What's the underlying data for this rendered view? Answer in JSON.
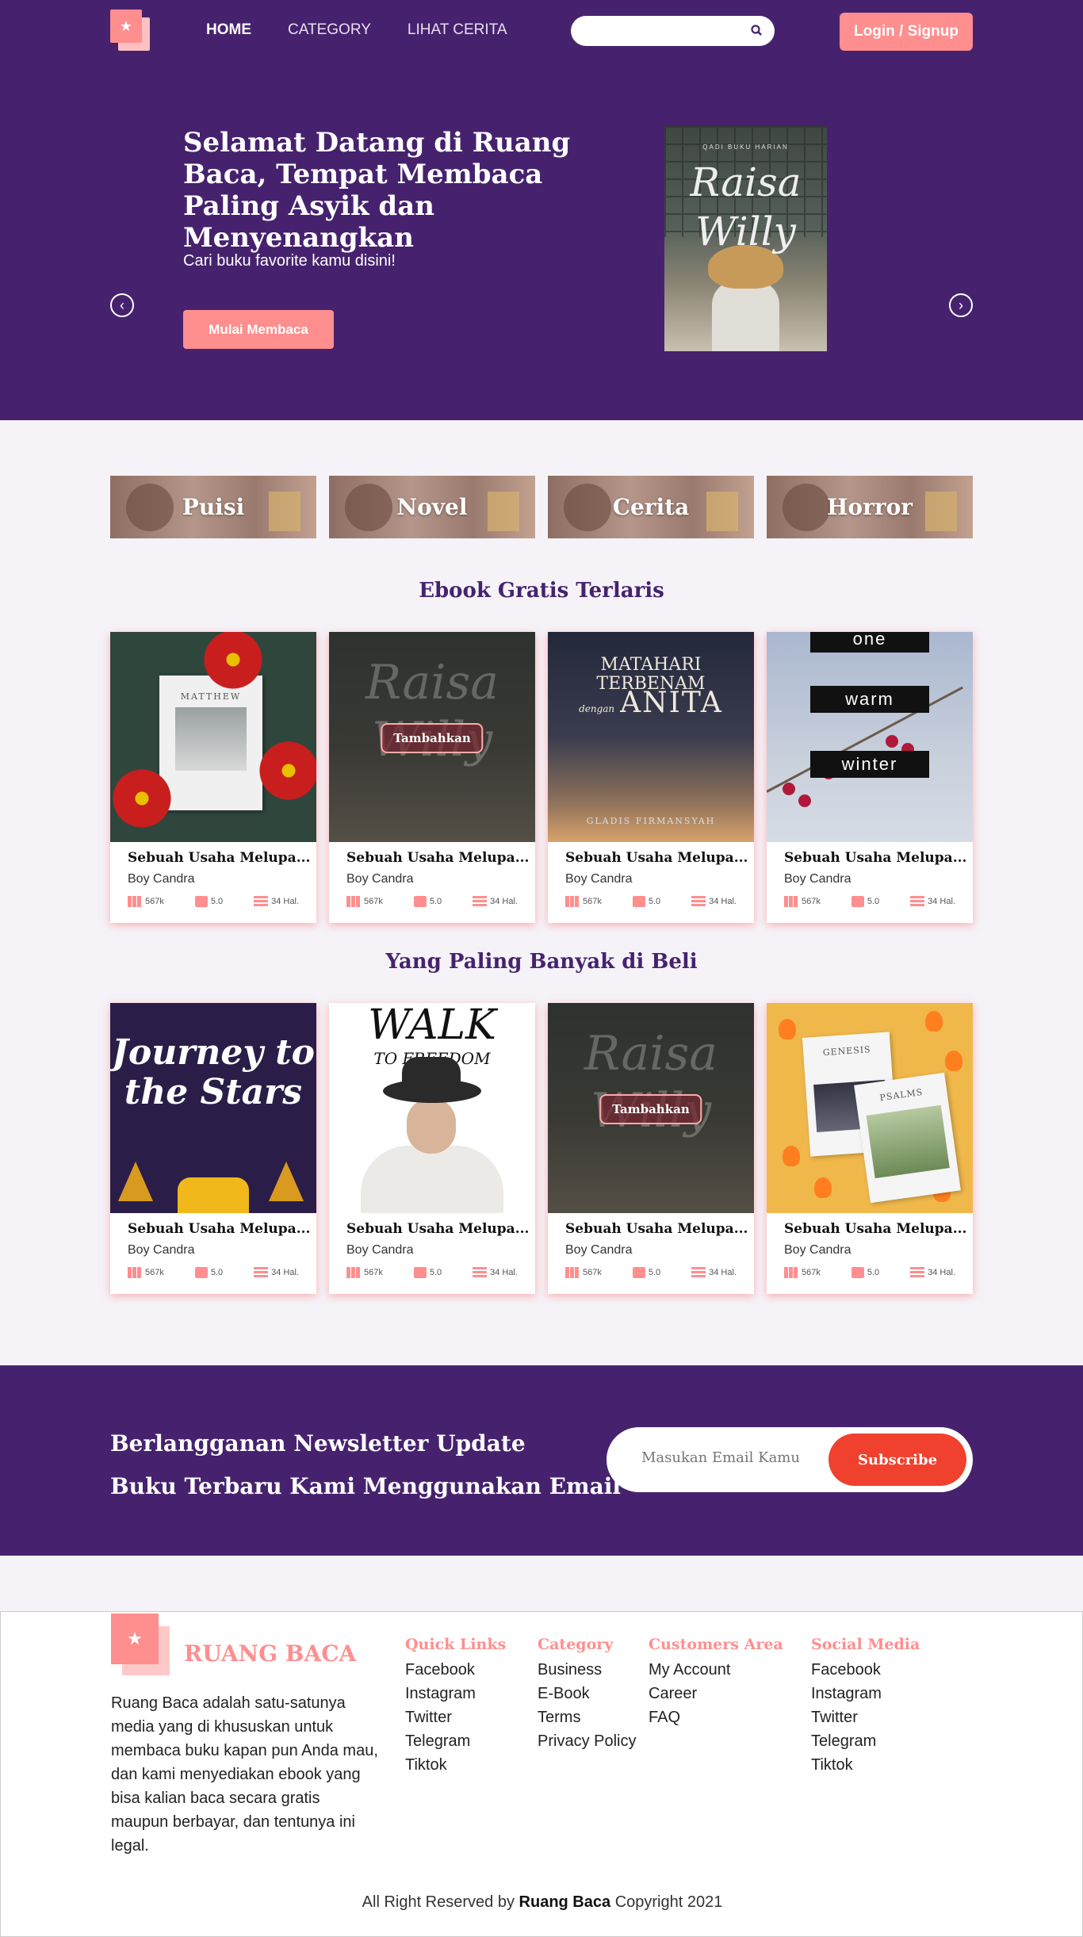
{
  "nav": {
    "links": [
      "HOME",
      "CATEGORY",
      "LIHAT CERITA"
    ],
    "search_placeholder": "",
    "login_label": "Login / Signup"
  },
  "hero": {
    "title": "Selamat Datang di Ruang Baca, Tempat Membaca Paling Asyik dan Menyenangkan",
    "subtitle": "Cari buku favorite kamu disini!",
    "cta_label": "Mulai Membaca",
    "cover_small": "QADI BUKU HARIAN",
    "cover_title": "Raisa Willy"
  },
  "categories": [
    "Puisi",
    "Novel",
    "Cerita",
    "Horror"
  ],
  "sections": [
    {
      "title": "Ebook Gratis Terlaris",
      "books": [
        {
          "title": "Sebuah Usaha Melupa...",
          "author": "Boy Candra",
          "views": "567k",
          "rating": "5.0",
          "pages": "34 Hal.",
          "cover_text": "MATTHEW"
        },
        {
          "title": "Sebuah Usaha Melupa...",
          "author": "Boy Candra",
          "views": "567k",
          "rating": "5.0",
          "pages": "34 Hal.",
          "cover_text": "Raisa Willy",
          "overlay": "Tambahkan"
        },
        {
          "title": "Sebuah Usaha Melupa...",
          "author": "Boy Candra",
          "views": "567k",
          "rating": "5.0",
          "pages": "34 Hal.",
          "cover_text": "MATAHARI TERBENAM",
          "cover_text2": "ANITA",
          "cover_text3": "dengan",
          "cover_author": "GLADIS FIRMANSYAH"
        },
        {
          "title": "Sebuah Usaha Melupa...",
          "author": "Boy Candra",
          "views": "567k",
          "rating": "5.0",
          "pages": "34 Hal.",
          "cover_words": [
            "one",
            "warm",
            "winter"
          ]
        }
      ]
    },
    {
      "title": "Yang Paling Banyak di Beli",
      "books": [
        {
          "title": "Sebuah Usaha Melupa...",
          "author": "Boy Candra",
          "views": "567k",
          "rating": "5.0",
          "pages": "34 Hal.",
          "cover_text": "Journey to the Stars"
        },
        {
          "title": "Sebuah Usaha Melupa...",
          "author": "Boy Candra",
          "views": "567k",
          "rating": "5.0",
          "pages": "34 Hal.",
          "cover_text": "WALK",
          "cover_text2": "TO FREEDOM"
        },
        {
          "title": "Sebuah Usaha Melupa...",
          "author": "Boy Candra",
          "views": "567k",
          "rating": "5.0",
          "pages": "34 Hal.",
          "cover_text": "Raisa Willy",
          "overlay": "Tambahkan"
        },
        {
          "title": "Sebuah Usaha Melupa...",
          "author": "Boy Candra",
          "views": "567k",
          "rating": "5.0",
          "pages": "34 Hal.",
          "cover_text": "GENESIS",
          "cover_text2": "PSALMS"
        }
      ]
    }
  ],
  "newsletter": {
    "line1": "Berlangganan Newsletter Update",
    "line2": "Buku Terbaru Kami Menggunakan Email",
    "placeholder": "Masukan Email Kamu",
    "button": "Subscribe"
  },
  "footer": {
    "brand": "RUANG BACA",
    "description": "Ruang Baca adalah satu-satunya media yang di khususkan untuk membaca buku kapan pun Anda mau, dan kami menyediakan ebook yang bisa kalian baca secara gratis maupun berbayar, dan tentunya ini legal.",
    "columns": [
      {
        "title": "Quick Links",
        "items": [
          "Facebook",
          "Instagram",
          "Twitter",
          "Telegram",
          "Tiktok"
        ]
      },
      {
        "title": "Category",
        "items": [
          "Business",
          "E-Book",
          "Terms",
          "Privacy Policy"
        ]
      },
      {
        "title": "Customers Area",
        "items": [
          "My Account",
          "Career",
          "FAQ"
        ]
      },
      {
        "title": "Social Media",
        "items": [
          "Facebook",
          "Instagram",
          "Twitter",
          "Telegram",
          "Tiktok"
        ]
      }
    ],
    "copyright_prefix": "All Right Reserved by",
    "copyright_brand": "Ruang Baca",
    "copyright_suffix": "Copyright 2021"
  },
  "colors": {
    "primary": "#46226e",
    "accent": "#ff8e8e",
    "subscribe": "#f0412e"
  },
  "icons": [
    "star-icon",
    "search-icon",
    "chevron-left-icon",
    "chevron-right-icon",
    "views-icon",
    "rating-icon",
    "pages-icon"
  ]
}
